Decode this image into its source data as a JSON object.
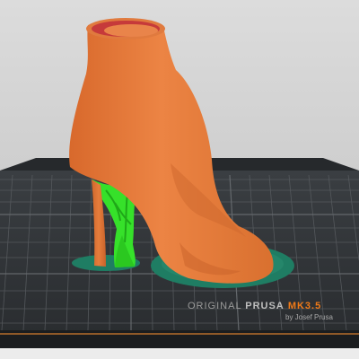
{
  "scene": {
    "object": "high-heel boot model",
    "support": "tree support",
    "colors": {
      "background_top": "#dcdcdc",
      "bed": "#2e3236",
      "grid_line": "#55595d",
      "model": "#e0773a",
      "model_inner": "#c63a3a",
      "support": "#36e12a",
      "brim": "#1f7d63"
    }
  },
  "bed_logo": {
    "prefix": "ORIGINAL",
    "brand": "PRUSA",
    "model": "MK3.5",
    "byline": "by Josef Prusa"
  }
}
